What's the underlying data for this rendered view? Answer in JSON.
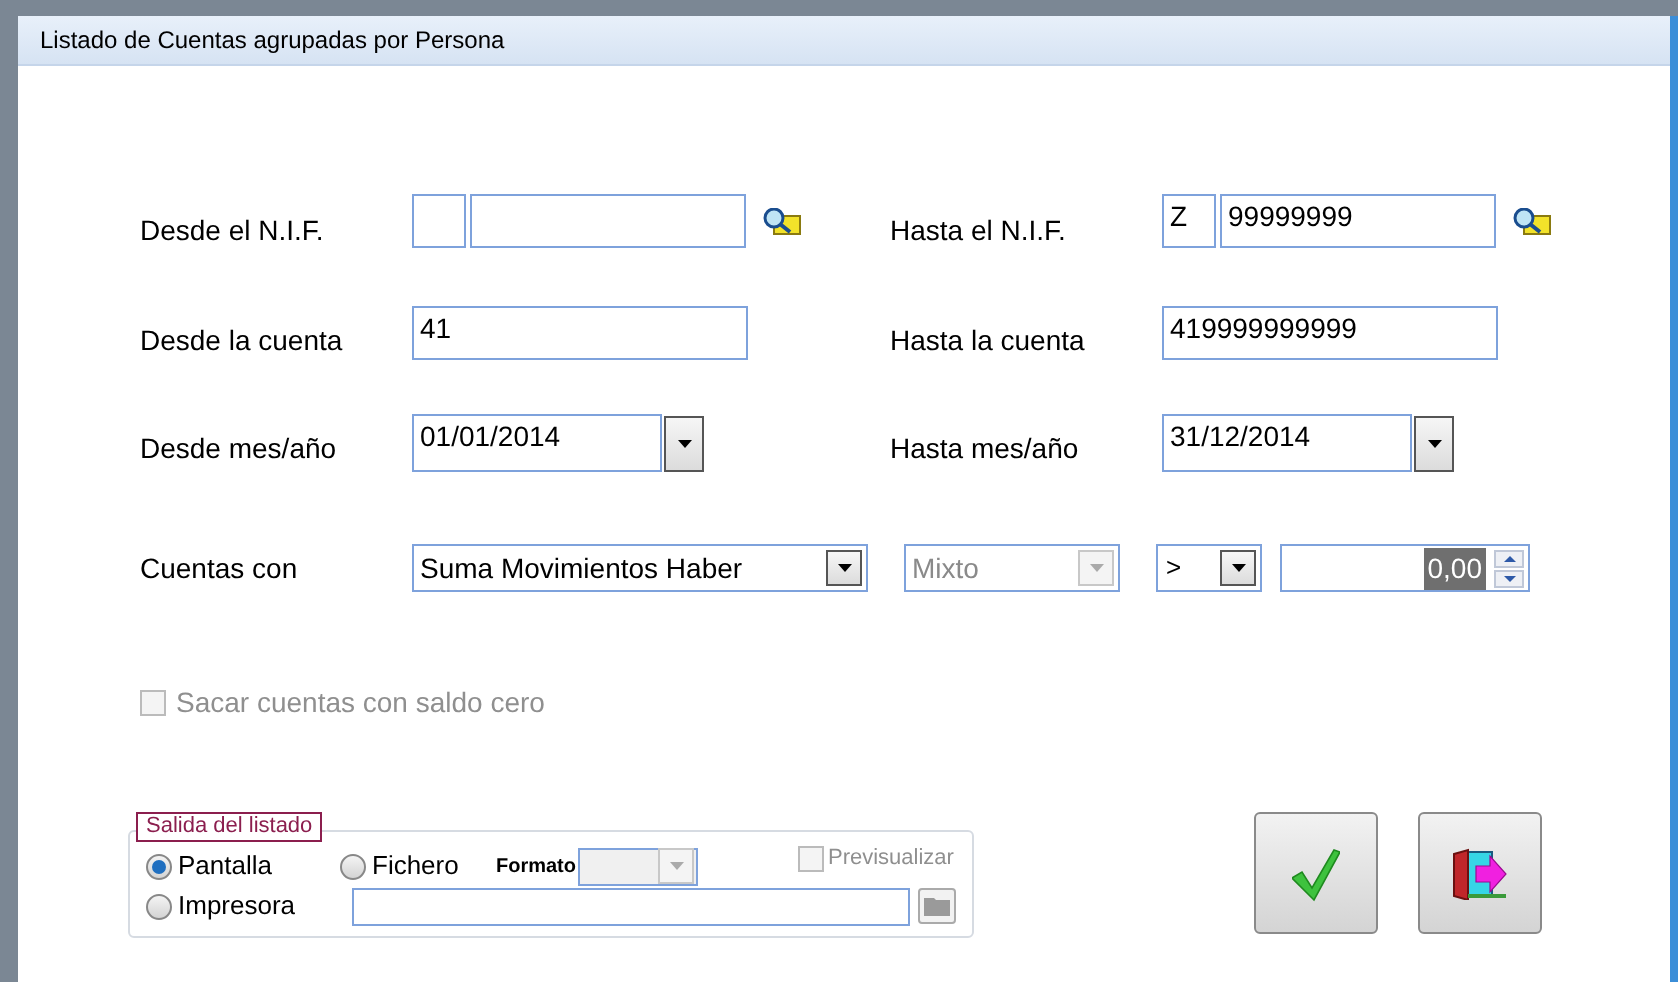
{
  "window": {
    "title": "Listado de Cuentas agrupadas por Persona"
  },
  "nif_range": [
    {
      "label": "Desde el N.I.F."
    },
    {
      "label": "Hasta el N.I.F.",
      "letter": "Z",
      "number": "99999999"
    }
  ],
  "account_range": [
    {
      "label": "Desde la cuenta",
      "value": "41"
    },
    {
      "label": "Hasta la cuenta",
      "value": "419999999999"
    }
  ],
  "date_range": [
    {
      "label": "Desde mes/año",
      "value": "01/01/2014"
    },
    {
      "label": "Hasta mes/año",
      "value": "31/12/2014"
    }
  ],
  "filter": {
    "label": "Cuentas con",
    "field": "Suma Movimientos Haber",
    "type": {
      "value": "Mixto",
      "disabled": true
    },
    "operator": ">",
    "amount": "0,00"
  },
  "zero_balance": {
    "label": "Sacar cuentas con saldo cero",
    "checked": false,
    "disabled": true
  },
  "output": {
    "legend": "Salida del listado",
    "options": [
      {
        "label": "Pantalla",
        "selected": true
      },
      {
        "label": "Fichero",
        "selected": false
      },
      {
        "label": "Impresora",
        "selected": false
      }
    ],
    "format_label": "Formato",
    "format_disabled": true,
    "preview": {
      "label": "Previsualizar",
      "checked": false,
      "disabled": true
    }
  }
}
